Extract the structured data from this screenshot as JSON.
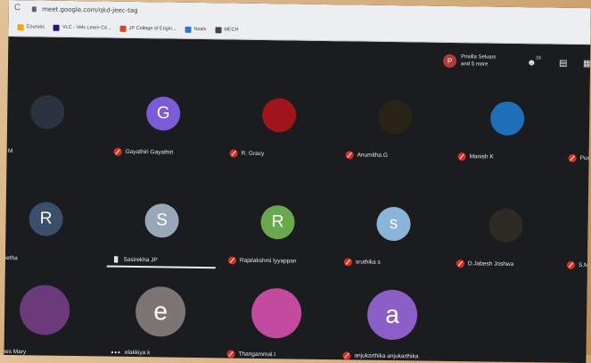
{
  "browser": {
    "url": "meet.google.com/qkd-jeec-tag",
    "bookmarks": [
      {
        "label": "Courses",
        "color": "#f2a900"
      },
      {
        "label": "VLC - Vels Learn Ce...",
        "color": "#1a1a8a"
      },
      {
        "label": "JP College of Engin...",
        "color": "#d4432c"
      },
      {
        "label": "Nxals",
        "color": "#2a76c9"
      },
      {
        "label": "MECH",
        "color": "#444"
      }
    ]
  },
  "meet": {
    "presenter": {
      "initial": "P",
      "line1": "Prisilla Selvam",
      "line2": "and 5 more"
    },
    "participant_count": "23"
  },
  "participants": [
    {
      "name": "rga M",
      "initial": "",
      "color": "#2b3340",
      "muted": false
    },
    {
      "name": "Gayathiri Gayathiri",
      "initial": "G",
      "color": "#7b5cd6",
      "muted": true
    },
    {
      "name": "R. Gracy",
      "initial": "",
      "color": "#a0141c",
      "muted": true
    },
    {
      "name": "Anumitha.G",
      "initial": "",
      "color": "#2a2418",
      "muted": true
    },
    {
      "name": "Manish K",
      "initial": "",
      "color": "#1f6fb8",
      "muted": true
    },
    {
      "name": "Pushp",
      "initial": "",
      "color": "#1b1c20",
      "muted": true
    },
    {
      "name": "i Seetha",
      "initial": "R",
      "color": "#3b4f6b",
      "muted": false
    },
    {
      "name": "Sasirekha JP",
      "initial": "S",
      "color": "#9aa7b8",
      "muted": false,
      "speaking": true
    },
    {
      "name": "Rajalakshmi Iyyappan",
      "initial": "R",
      "color": "#6aa84f",
      "muted": true
    },
    {
      "name": "sruthika s",
      "initial": "s",
      "color": "#8ab4d8",
      "muted": true
    },
    {
      "name": "D.Jabesh Joshwa",
      "initial": "",
      "color": "#2e2a26",
      "muted": true
    },
    {
      "name": "S.Mari",
      "initial": "",
      "color": "#1b1c20",
      "muted": true
    },
    {
      "name": "Agnes Mary",
      "initial": "",
      "color": "#6b3a7a",
      "muted": false
    },
    {
      "name": "elakkiya k",
      "initial": "e",
      "color": "#7d7474",
      "muted": false,
      "dots": true
    },
    {
      "name": "Thangammal.I",
      "initial": "",
      "color": "#c34a9e",
      "muted": true
    },
    {
      "name": "anjukarthika anjukarthika",
      "initial": "a",
      "color": "#8b5fc7",
      "muted": true
    }
  ]
}
